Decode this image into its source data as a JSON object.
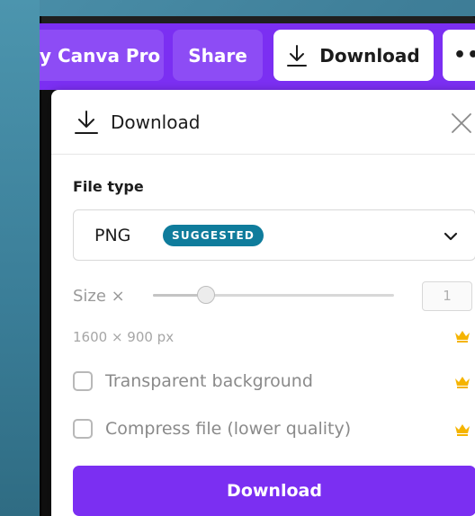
{
  "topbar": {
    "pro_label": "y Canva Pro",
    "share_label": "Share",
    "download_label": "Download",
    "more_label": "••"
  },
  "panel": {
    "title": "Download",
    "file_type_label": "File type",
    "file_type_value": "PNG",
    "suggested_badge": "SUGGESTED",
    "size_label": "Size ×",
    "size_value": "1",
    "size_slider_fraction": 0.22,
    "dimensions": "1600 × 900 px",
    "options": [
      {
        "label": "Transparent background",
        "checked": false,
        "pro": true
      },
      {
        "label": "Compress file (lower quality)",
        "checked": false,
        "pro": true
      }
    ],
    "download_button": "Download"
  },
  "colors": {
    "brand_purple": "#7b2ff2",
    "suggested_badge": "#0f7c9c",
    "crown": "#f5b400"
  },
  "icons": [
    "download-icon",
    "close-icon",
    "chevron-down-icon",
    "crown-icon",
    "more-icon"
  ]
}
